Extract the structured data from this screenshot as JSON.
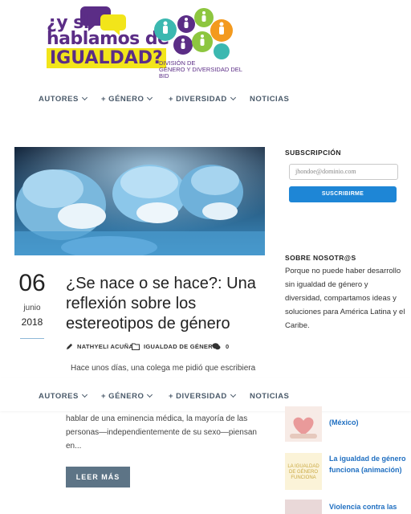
{
  "logo": {
    "line1": "¿y si",
    "line2": "hablamos de",
    "line3": "IGUALDAD?",
    "subtitle_line1": "DIVISIÓN DE",
    "subtitle_line2": "GÉNERO Y DIVERSIDAD DEL BID",
    "colors": {
      "purple": "#5b2d86",
      "yellow": "#f2e51a",
      "teal": "#3bb8b0",
      "orange": "#f39a1e",
      "green": "#8dc63f"
    }
  },
  "nav": {
    "items": [
      {
        "label": "AUTORES",
        "has_dropdown": true
      },
      {
        "label": "+ GÉNERO",
        "has_dropdown": true
      },
      {
        "label": "+ DIVERSIDAD",
        "has_dropdown": true
      },
      {
        "label": "NOTICIAS",
        "has_dropdown": false
      }
    ]
  },
  "post": {
    "day": "06",
    "month": "junio",
    "year": "2018",
    "title": "¿Se nace o se hace?: Una reflexión sobre los estereotipos de género",
    "author": "NATHYELI ACUÑA",
    "category": "IGUALDAD DE GÉNERO",
    "comments": "0",
    "excerpt_line1": "Hace unos días, una colega me pidió que escribiera",
    "excerpt_line2": "hablar de una eminencia médica, la mayoría de las",
    "excerpt_line3": "personas—independientemente de su sexo—piensan",
    "excerpt_line4": "en...",
    "read_more": "LEER MÁS"
  },
  "sidebar": {
    "subscription_heading": "SUBSCRIPCIÓN",
    "email_placeholder": "jhondoe@dominio.com",
    "subscribe_label": "SUSCRIBIRME",
    "about_heading": "SOBRE NOSOTR@S",
    "about_text": "Porque no puede haber desarrollo sin igualdad de género y diversidad, compartamos ideas y soluciones para América Latina y el Caribe.",
    "related": [
      {
        "title_partial": "(México)"
      },
      {
        "title": "La igualdad de género funciona (animación)",
        "thumb_text": "LA IGUALDAD DE GÉNERO FUNCIONA"
      },
      {
        "title": "Violencia contra las"
      }
    ]
  },
  "accent_color": "#1e86d6"
}
